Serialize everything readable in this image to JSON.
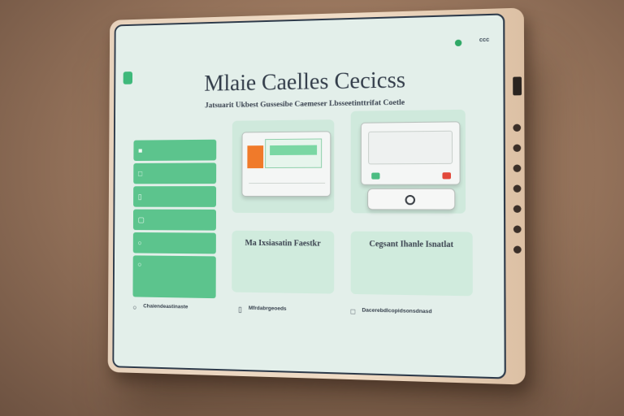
{
  "header": {
    "title": "Mlaie Caelles Cecicss",
    "subtitle": "Jatsuarit Ukbest Gussesibe Caemeser Lbsseetinttrifat Coetle",
    "status_label": "ccc"
  },
  "sidebar": {
    "items": [
      {
        "icon": "■",
        "label": ""
      },
      {
        "icon": "□",
        "label": ""
      },
      {
        "icon": "▯",
        "label": ""
      },
      {
        "icon": "▢",
        "label": ""
      },
      {
        "icon": "○",
        "label": ""
      },
      {
        "icon": "○",
        "label": ""
      }
    ]
  },
  "cards": [
    {
      "title": "Ma Ixsiasatin Faestkr",
      "body": ""
    },
    {
      "title": "Cegsant Ihanle Isnatlat",
      "body": ""
    }
  ],
  "footer": [
    {
      "icon": "○",
      "label": "Chaiendeastinaste"
    },
    {
      "icon": "▯",
      "label": "Mfrdabrgeoeds"
    },
    {
      "icon": "□",
      "label": "Dacerebdlcopidsonsdnasd"
    }
  ],
  "colors": {
    "accent_green": "#5cc48d",
    "card_green": "#d0ebdd",
    "screen_bg": "#e3efea",
    "orange": "#f07a2a",
    "bezel": "#ecd7c0"
  }
}
